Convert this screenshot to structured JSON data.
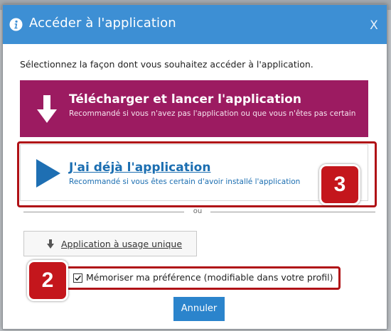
{
  "dialog": {
    "title": "Accéder à l'application",
    "close_label": "X",
    "intro": "Sélectionnez la façon dont vous souhaitez accéder à l'application.",
    "download": {
      "title": "Télécharger et lancer l'application",
      "subtitle": "Recommandé si vous n'avez pas l'application ou que vous n'êtes pas certain"
    },
    "already_have": {
      "title": "J'ai déjà l'application",
      "subtitle": "Recommandé si vous êtes certain d'avoir installé l'application"
    },
    "divider_label": "ou",
    "single_use_label": "Application à usage unique",
    "remember": {
      "checked": true,
      "label": "Mémoriser ma préférence (modifiable dans votre profil)"
    },
    "cancel_label": "Annuler"
  },
  "callouts": {
    "step_3": "3",
    "step_2": "2"
  },
  "icons": {
    "title": "info-icon",
    "download": "arrow-down-icon",
    "already_have": "play-icon",
    "single_use": "arrow-down-icon",
    "checkbox": "checkmark-icon"
  },
  "colors": {
    "title_bar": "#3d8fd4",
    "download_bg": "#9c1b61",
    "link_blue": "#1b6eb1",
    "callout_red": "#c4161c",
    "cancel_bg": "#2b84cc"
  }
}
